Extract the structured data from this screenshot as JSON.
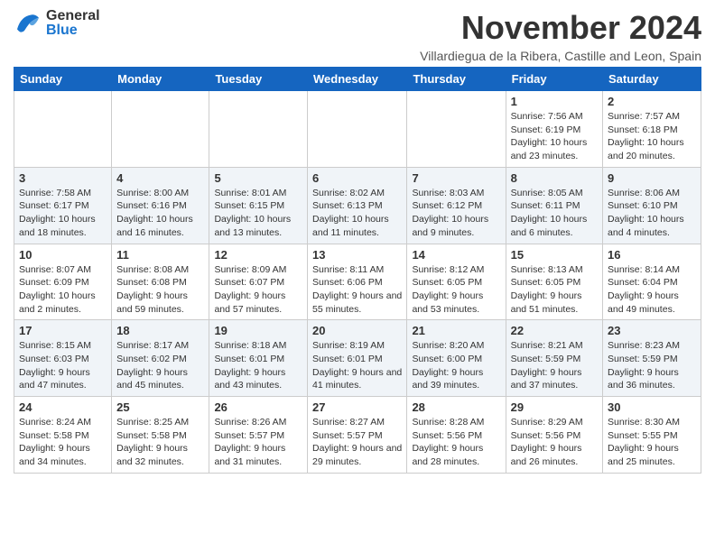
{
  "header": {
    "logo_general": "General",
    "logo_blue": "Blue",
    "month_title": "November 2024",
    "location": "Villardiegua de la Ribera, Castille and Leon, Spain"
  },
  "days_of_week": [
    "Sunday",
    "Monday",
    "Tuesday",
    "Wednesday",
    "Thursday",
    "Friday",
    "Saturday"
  ],
  "weeks": [
    [
      {
        "day": "",
        "info": ""
      },
      {
        "day": "",
        "info": ""
      },
      {
        "day": "",
        "info": ""
      },
      {
        "day": "",
        "info": ""
      },
      {
        "day": "",
        "info": ""
      },
      {
        "day": "1",
        "info": "Sunrise: 7:56 AM\nSunset: 6:19 PM\nDaylight: 10 hours and 23 minutes."
      },
      {
        "day": "2",
        "info": "Sunrise: 7:57 AM\nSunset: 6:18 PM\nDaylight: 10 hours and 20 minutes."
      }
    ],
    [
      {
        "day": "3",
        "info": "Sunrise: 7:58 AM\nSunset: 6:17 PM\nDaylight: 10 hours and 18 minutes."
      },
      {
        "day": "4",
        "info": "Sunrise: 8:00 AM\nSunset: 6:16 PM\nDaylight: 10 hours and 16 minutes."
      },
      {
        "day": "5",
        "info": "Sunrise: 8:01 AM\nSunset: 6:15 PM\nDaylight: 10 hours and 13 minutes."
      },
      {
        "day": "6",
        "info": "Sunrise: 8:02 AM\nSunset: 6:13 PM\nDaylight: 10 hours and 11 minutes."
      },
      {
        "day": "7",
        "info": "Sunrise: 8:03 AM\nSunset: 6:12 PM\nDaylight: 10 hours and 9 minutes."
      },
      {
        "day": "8",
        "info": "Sunrise: 8:05 AM\nSunset: 6:11 PM\nDaylight: 10 hours and 6 minutes."
      },
      {
        "day": "9",
        "info": "Sunrise: 8:06 AM\nSunset: 6:10 PM\nDaylight: 10 hours and 4 minutes."
      }
    ],
    [
      {
        "day": "10",
        "info": "Sunrise: 8:07 AM\nSunset: 6:09 PM\nDaylight: 10 hours and 2 minutes."
      },
      {
        "day": "11",
        "info": "Sunrise: 8:08 AM\nSunset: 6:08 PM\nDaylight: 9 hours and 59 minutes."
      },
      {
        "day": "12",
        "info": "Sunrise: 8:09 AM\nSunset: 6:07 PM\nDaylight: 9 hours and 57 minutes."
      },
      {
        "day": "13",
        "info": "Sunrise: 8:11 AM\nSunset: 6:06 PM\nDaylight: 9 hours and 55 minutes."
      },
      {
        "day": "14",
        "info": "Sunrise: 8:12 AM\nSunset: 6:05 PM\nDaylight: 9 hours and 53 minutes."
      },
      {
        "day": "15",
        "info": "Sunrise: 8:13 AM\nSunset: 6:05 PM\nDaylight: 9 hours and 51 minutes."
      },
      {
        "day": "16",
        "info": "Sunrise: 8:14 AM\nSunset: 6:04 PM\nDaylight: 9 hours and 49 minutes."
      }
    ],
    [
      {
        "day": "17",
        "info": "Sunrise: 8:15 AM\nSunset: 6:03 PM\nDaylight: 9 hours and 47 minutes."
      },
      {
        "day": "18",
        "info": "Sunrise: 8:17 AM\nSunset: 6:02 PM\nDaylight: 9 hours and 45 minutes."
      },
      {
        "day": "19",
        "info": "Sunrise: 8:18 AM\nSunset: 6:01 PM\nDaylight: 9 hours and 43 minutes."
      },
      {
        "day": "20",
        "info": "Sunrise: 8:19 AM\nSunset: 6:01 PM\nDaylight: 9 hours and 41 minutes."
      },
      {
        "day": "21",
        "info": "Sunrise: 8:20 AM\nSunset: 6:00 PM\nDaylight: 9 hours and 39 minutes."
      },
      {
        "day": "22",
        "info": "Sunrise: 8:21 AM\nSunset: 5:59 PM\nDaylight: 9 hours and 37 minutes."
      },
      {
        "day": "23",
        "info": "Sunrise: 8:23 AM\nSunset: 5:59 PM\nDaylight: 9 hours and 36 minutes."
      }
    ],
    [
      {
        "day": "24",
        "info": "Sunrise: 8:24 AM\nSunset: 5:58 PM\nDaylight: 9 hours and 34 minutes."
      },
      {
        "day": "25",
        "info": "Sunrise: 8:25 AM\nSunset: 5:58 PM\nDaylight: 9 hours and 32 minutes."
      },
      {
        "day": "26",
        "info": "Sunrise: 8:26 AM\nSunset: 5:57 PM\nDaylight: 9 hours and 31 minutes."
      },
      {
        "day": "27",
        "info": "Sunrise: 8:27 AM\nSunset: 5:57 PM\nDaylight: 9 hours and 29 minutes."
      },
      {
        "day": "28",
        "info": "Sunrise: 8:28 AM\nSunset: 5:56 PM\nDaylight: 9 hours and 28 minutes."
      },
      {
        "day": "29",
        "info": "Sunrise: 8:29 AM\nSunset: 5:56 PM\nDaylight: 9 hours and 26 minutes."
      },
      {
        "day": "30",
        "info": "Sunrise: 8:30 AM\nSunset: 5:55 PM\nDaylight: 9 hours and 25 minutes."
      }
    ]
  ]
}
